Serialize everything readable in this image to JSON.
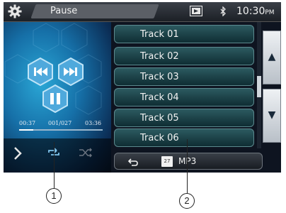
{
  "status_bar": {
    "state": "Pause",
    "clock": "10:30",
    "clock_suffix": "PM",
    "icons": [
      "gear-icon",
      "media-source-icon",
      "bluetooth-icon"
    ]
  },
  "player": {
    "time_elapsed": "00:37",
    "track_count": "001/027",
    "time_total": "03:36",
    "progress_fraction": 0.17,
    "buttons": [
      "previous-button",
      "next-button",
      "pause-button"
    ],
    "modes": [
      "repeat-icon",
      "shuffle-icon"
    ]
  },
  "tracks": [
    "Track 01",
    "Track 02",
    "Track 03",
    "Track 04",
    "Track 05",
    "Track 06"
  ],
  "bottom_bar": {
    "source_number": "27",
    "source_label": "MP3"
  },
  "callouts": [
    "1",
    "2"
  ],
  "colors": {
    "accent_blue": "#1670a8",
    "track_button": "#2c5a60",
    "screen_bg": "#0e1420"
  }
}
